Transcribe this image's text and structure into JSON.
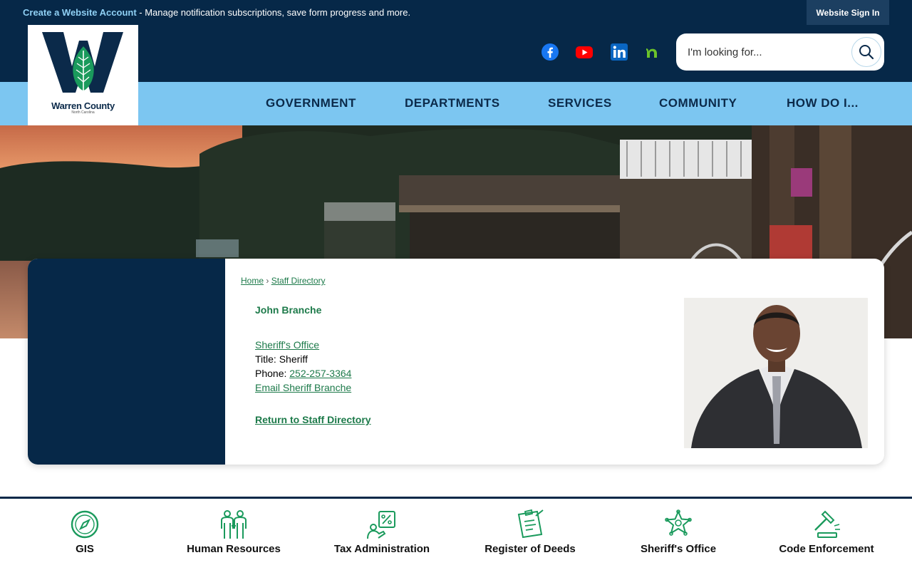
{
  "top_bar": {
    "create_account_link": "Create a Website Account",
    "message": " - Manage notification subscriptions, save form progress and more.",
    "sign_in_button": "Website Sign In"
  },
  "logo": {
    "name": "Warren County",
    "subtitle": "North Carolina"
  },
  "social": [
    {
      "name": "facebook-icon",
      "color": "#1877f2"
    },
    {
      "name": "youtube-icon",
      "color": "#ff0000"
    },
    {
      "name": "linkedin-icon",
      "color": "#0a66c2"
    },
    {
      "name": "nextdoor-icon",
      "color": "#6bc32a"
    }
  ],
  "search": {
    "placeholder": "I'm looking for..."
  },
  "nav": {
    "government": "GOVERNMENT",
    "departments": "DEPARTMENTS",
    "services": "SERVICES",
    "community": "COMMUNITY",
    "how_do_i": "HOW DO I..."
  },
  "breadcrumb": {
    "home": "Home",
    "separator": "›",
    "staff_directory": "Staff Directory"
  },
  "staff": {
    "name": "John Branche",
    "department": "Sheriff's Office",
    "title_label": "Title:",
    "title_value": "Sheriff",
    "phone_label": "Phone:",
    "phone_value": "252-257-3364",
    "email_link": "Email Sheriff Branche",
    "return_link": "Return to Staff Directory"
  },
  "quick_links": [
    {
      "label": "GIS",
      "icon": "compass-icon"
    },
    {
      "label": "Human Resources",
      "icon": "people-icon"
    },
    {
      "label": "Tax Administration",
      "icon": "tax-icon"
    },
    {
      "label": "Register of Deeds",
      "icon": "deed-icon"
    },
    {
      "label": "Sheriff's Office",
      "icon": "badge-icon"
    },
    {
      "label": "Code Enforcement",
      "icon": "gavel-icon"
    }
  ],
  "colors": {
    "navy": "#062848",
    "light_blue": "#7cc6f1",
    "green": "#1d7a4a",
    "icon_green": "#1a9a5c"
  }
}
